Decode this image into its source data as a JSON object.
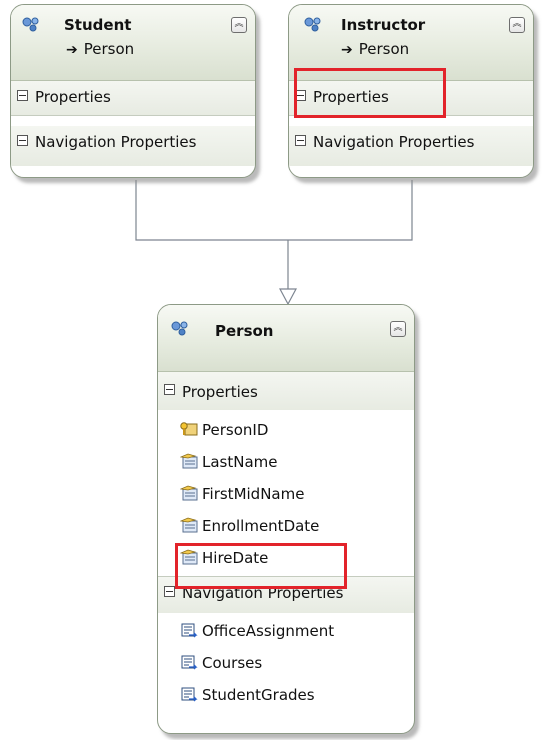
{
  "colors": {
    "highlight": "#e2232a",
    "connector": "#7d8590",
    "header": "#dde4d5"
  },
  "student": {
    "name": "Student",
    "base": "Person",
    "sections": {
      "properties": "Properties",
      "navigation": "Navigation Properties"
    }
  },
  "instructor": {
    "name": "Instructor",
    "base": "Person",
    "sections": {
      "properties": "Properties",
      "navigation": "Navigation Properties"
    }
  },
  "person": {
    "name": "Person",
    "sections": {
      "properties": "Properties",
      "navigation": "Navigation Properties"
    },
    "properties": [
      "PersonID",
      "LastName",
      "FirstMidName",
      "EnrollmentDate",
      "HireDate"
    ],
    "navigation": [
      "OfficeAssignment",
      "Courses",
      "StudentGrades"
    ]
  },
  "icons": {
    "entity": "entity-icon",
    "key_property": "key-property-icon",
    "property": "property-icon",
    "navigation": "navigation-property-icon",
    "collapse": "collapse-icon"
  }
}
